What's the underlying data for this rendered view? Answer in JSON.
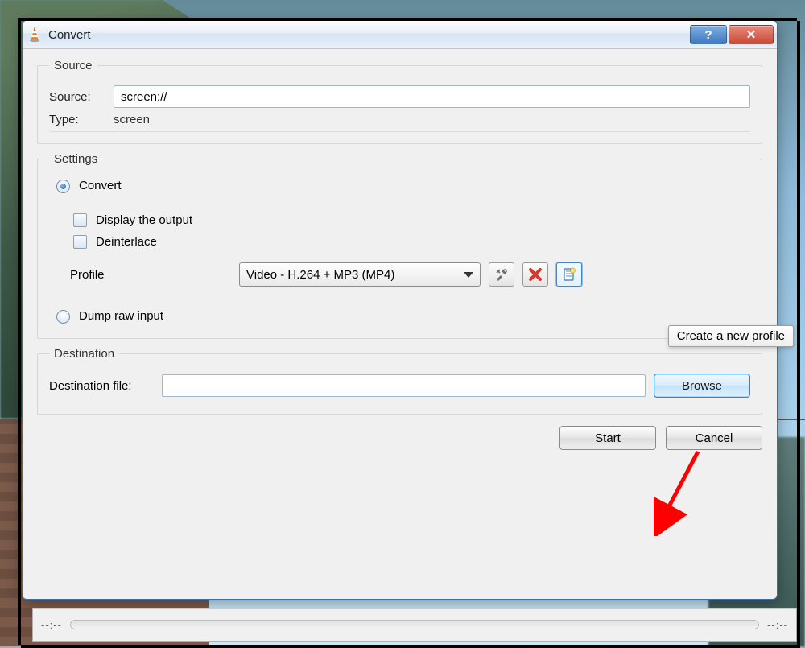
{
  "titlebar": {
    "title": "Convert"
  },
  "source": {
    "legend": "Source",
    "label": "Source:",
    "value": "screen://",
    "type_label": "Type:",
    "type_value": "screen"
  },
  "settings": {
    "legend": "Settings",
    "convert_label": "Convert",
    "display_output_label": "Display the output",
    "deinterlace_label": "Deinterlace",
    "profile_label": "Profile",
    "profile_selected": "Video - H.264 + MP3 (MP4)",
    "dump_raw_label": "Dump raw input"
  },
  "tooltip": {
    "new_profile": "Create a new profile"
  },
  "destination": {
    "legend": "Destination",
    "file_label": "Destination file:",
    "file_value": "",
    "browse_label": "Browse"
  },
  "buttons": {
    "start": "Start",
    "cancel": "Cancel"
  },
  "status": {
    "time_left": "--:--",
    "time_right": "--:--"
  },
  "colors": {
    "accent": "#2f86c8",
    "red": "#d6372e"
  }
}
